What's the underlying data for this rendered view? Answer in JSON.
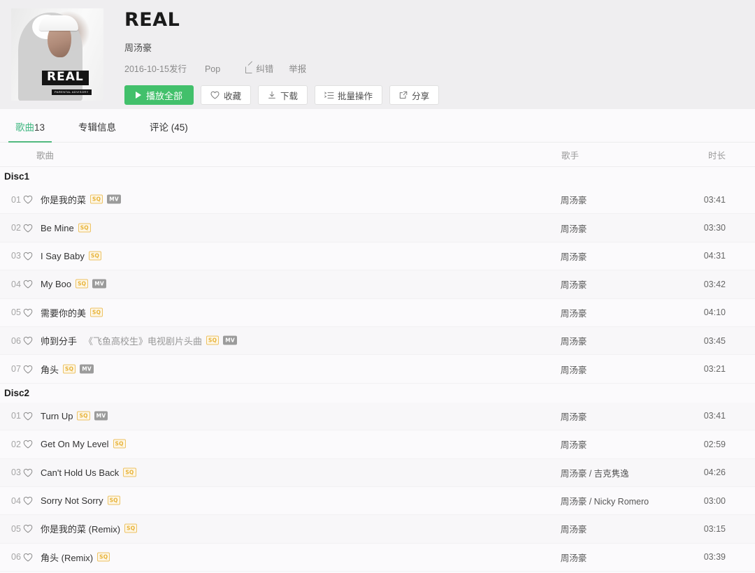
{
  "album": {
    "title": "REAL",
    "artist": "周汤豪",
    "release_date": "2016-10-15发行",
    "genre": "Pop",
    "report_error": "纠错",
    "report": "举报",
    "cover_logo_text": "REAL",
    "cover_explicit_text": "PARENTAL ADVISORY"
  },
  "actions": {
    "play_all": "播放全部",
    "favorite": "收藏",
    "download": "下载",
    "batch": "批量操作",
    "share": "分享"
  },
  "tabs": [
    {
      "label": "歌曲",
      "count": "13",
      "active": true
    },
    {
      "label": "专辑信息",
      "count": "",
      "active": false
    },
    {
      "label": "评论 (45)",
      "count": "",
      "active": false
    }
  ],
  "table": {
    "headers": {
      "song": "歌曲",
      "artist": "歌手",
      "duration": "时长"
    }
  },
  "discs": [
    {
      "name": "Disc1",
      "tracks": [
        {
          "num": "01",
          "title": "你是我的菜",
          "sub": "",
          "badges": [
            "SQ",
            "MV"
          ],
          "artist": "周汤豪",
          "duration": "03:41"
        },
        {
          "num": "02",
          "title": "Be Mine",
          "sub": "",
          "badges": [
            "SQ"
          ],
          "artist": "周汤豪",
          "duration": "03:30"
        },
        {
          "num": "03",
          "title": "I Say Baby",
          "sub": "",
          "badges": [
            "SQ"
          ],
          "artist": "周汤豪",
          "duration": "04:31"
        },
        {
          "num": "04",
          "title": "My Boo",
          "sub": "",
          "badges": [
            "SQ",
            "MV"
          ],
          "artist": "周汤豪",
          "duration": "03:42"
        },
        {
          "num": "05",
          "title": "需要你的美",
          "sub": "",
          "badges": [
            "SQ"
          ],
          "artist": "周汤豪",
          "duration": "04:10"
        },
        {
          "num": "06",
          "title": "帅到分手",
          "sub": "《飞鱼高校生》电视剧片头曲",
          "badges": [
            "SQ",
            "MV"
          ],
          "artist": "周汤豪",
          "duration": "03:45"
        },
        {
          "num": "07",
          "title": "角头",
          "sub": "",
          "badges": [
            "SQ",
            "MV"
          ],
          "artist": "周汤豪",
          "duration": "03:21"
        }
      ]
    },
    {
      "name": "Disc2",
      "tracks": [
        {
          "num": "01",
          "title": "Turn Up",
          "sub": "",
          "badges": [
            "SQ",
            "MV"
          ],
          "artist": "周汤豪",
          "duration": "03:41"
        },
        {
          "num": "02",
          "title": "Get On My Level",
          "sub": "",
          "badges": [
            "SQ"
          ],
          "artist": "周汤豪",
          "duration": "02:59"
        },
        {
          "num": "03",
          "title": "Can't Hold Us Back",
          "sub": "",
          "badges": [
            "SQ"
          ],
          "artist": "周汤豪 / 吉克隽逸",
          "duration": "04:26"
        },
        {
          "num": "04",
          "title": "Sorry Not Sorry",
          "sub": "",
          "badges": [
            "SQ"
          ],
          "artist": "周汤豪 / Nicky Romero",
          "duration": "03:00"
        },
        {
          "num": "05",
          "title": "你是我的菜 (Remix)",
          "sub": "",
          "badges": [
            "SQ"
          ],
          "artist": "周汤豪",
          "duration": "03:15"
        },
        {
          "num": "06",
          "title": "角头 (Remix)",
          "sub": "",
          "badges": [
            "SQ"
          ],
          "artist": "周汤豪",
          "duration": "03:39"
        }
      ]
    }
  ],
  "colors": {
    "accent_green": "#42c06b",
    "tab_green": "#43b883",
    "badge_sq": "#e8b339",
    "badge_mv": "#9b9b9b",
    "header_bg": "#efeef0"
  }
}
